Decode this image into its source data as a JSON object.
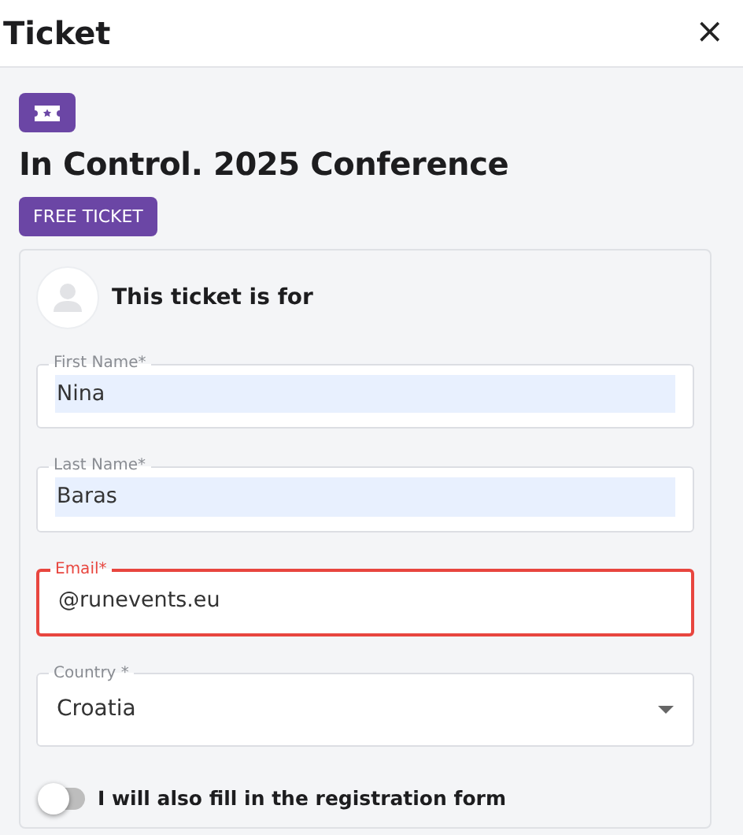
{
  "window": {
    "title": "Ticket",
    "close": "×"
  },
  "event": {
    "title": "In Control. 2025 Conference",
    "ticket_type": "FREE TICKET"
  },
  "form": {
    "heading": "This ticket is for",
    "fields": [
      {
        "kind": "input",
        "label": "First Name*",
        "value": "Nina",
        "autofilled": true,
        "error": false
      },
      {
        "kind": "input",
        "label": "Last Name*",
        "value": "Baras",
        "autofilled": true,
        "error": false
      },
      {
        "kind": "input",
        "label": "Email*",
        "value": "@runevents.eu",
        "autofilled": false,
        "error": true
      },
      {
        "kind": "select",
        "label": "Country *",
        "value": "Croatia",
        "autofilled": false,
        "error": false
      }
    ],
    "toggle": {
      "label": "I will also fill in the registration form",
      "on": false
    }
  }
}
